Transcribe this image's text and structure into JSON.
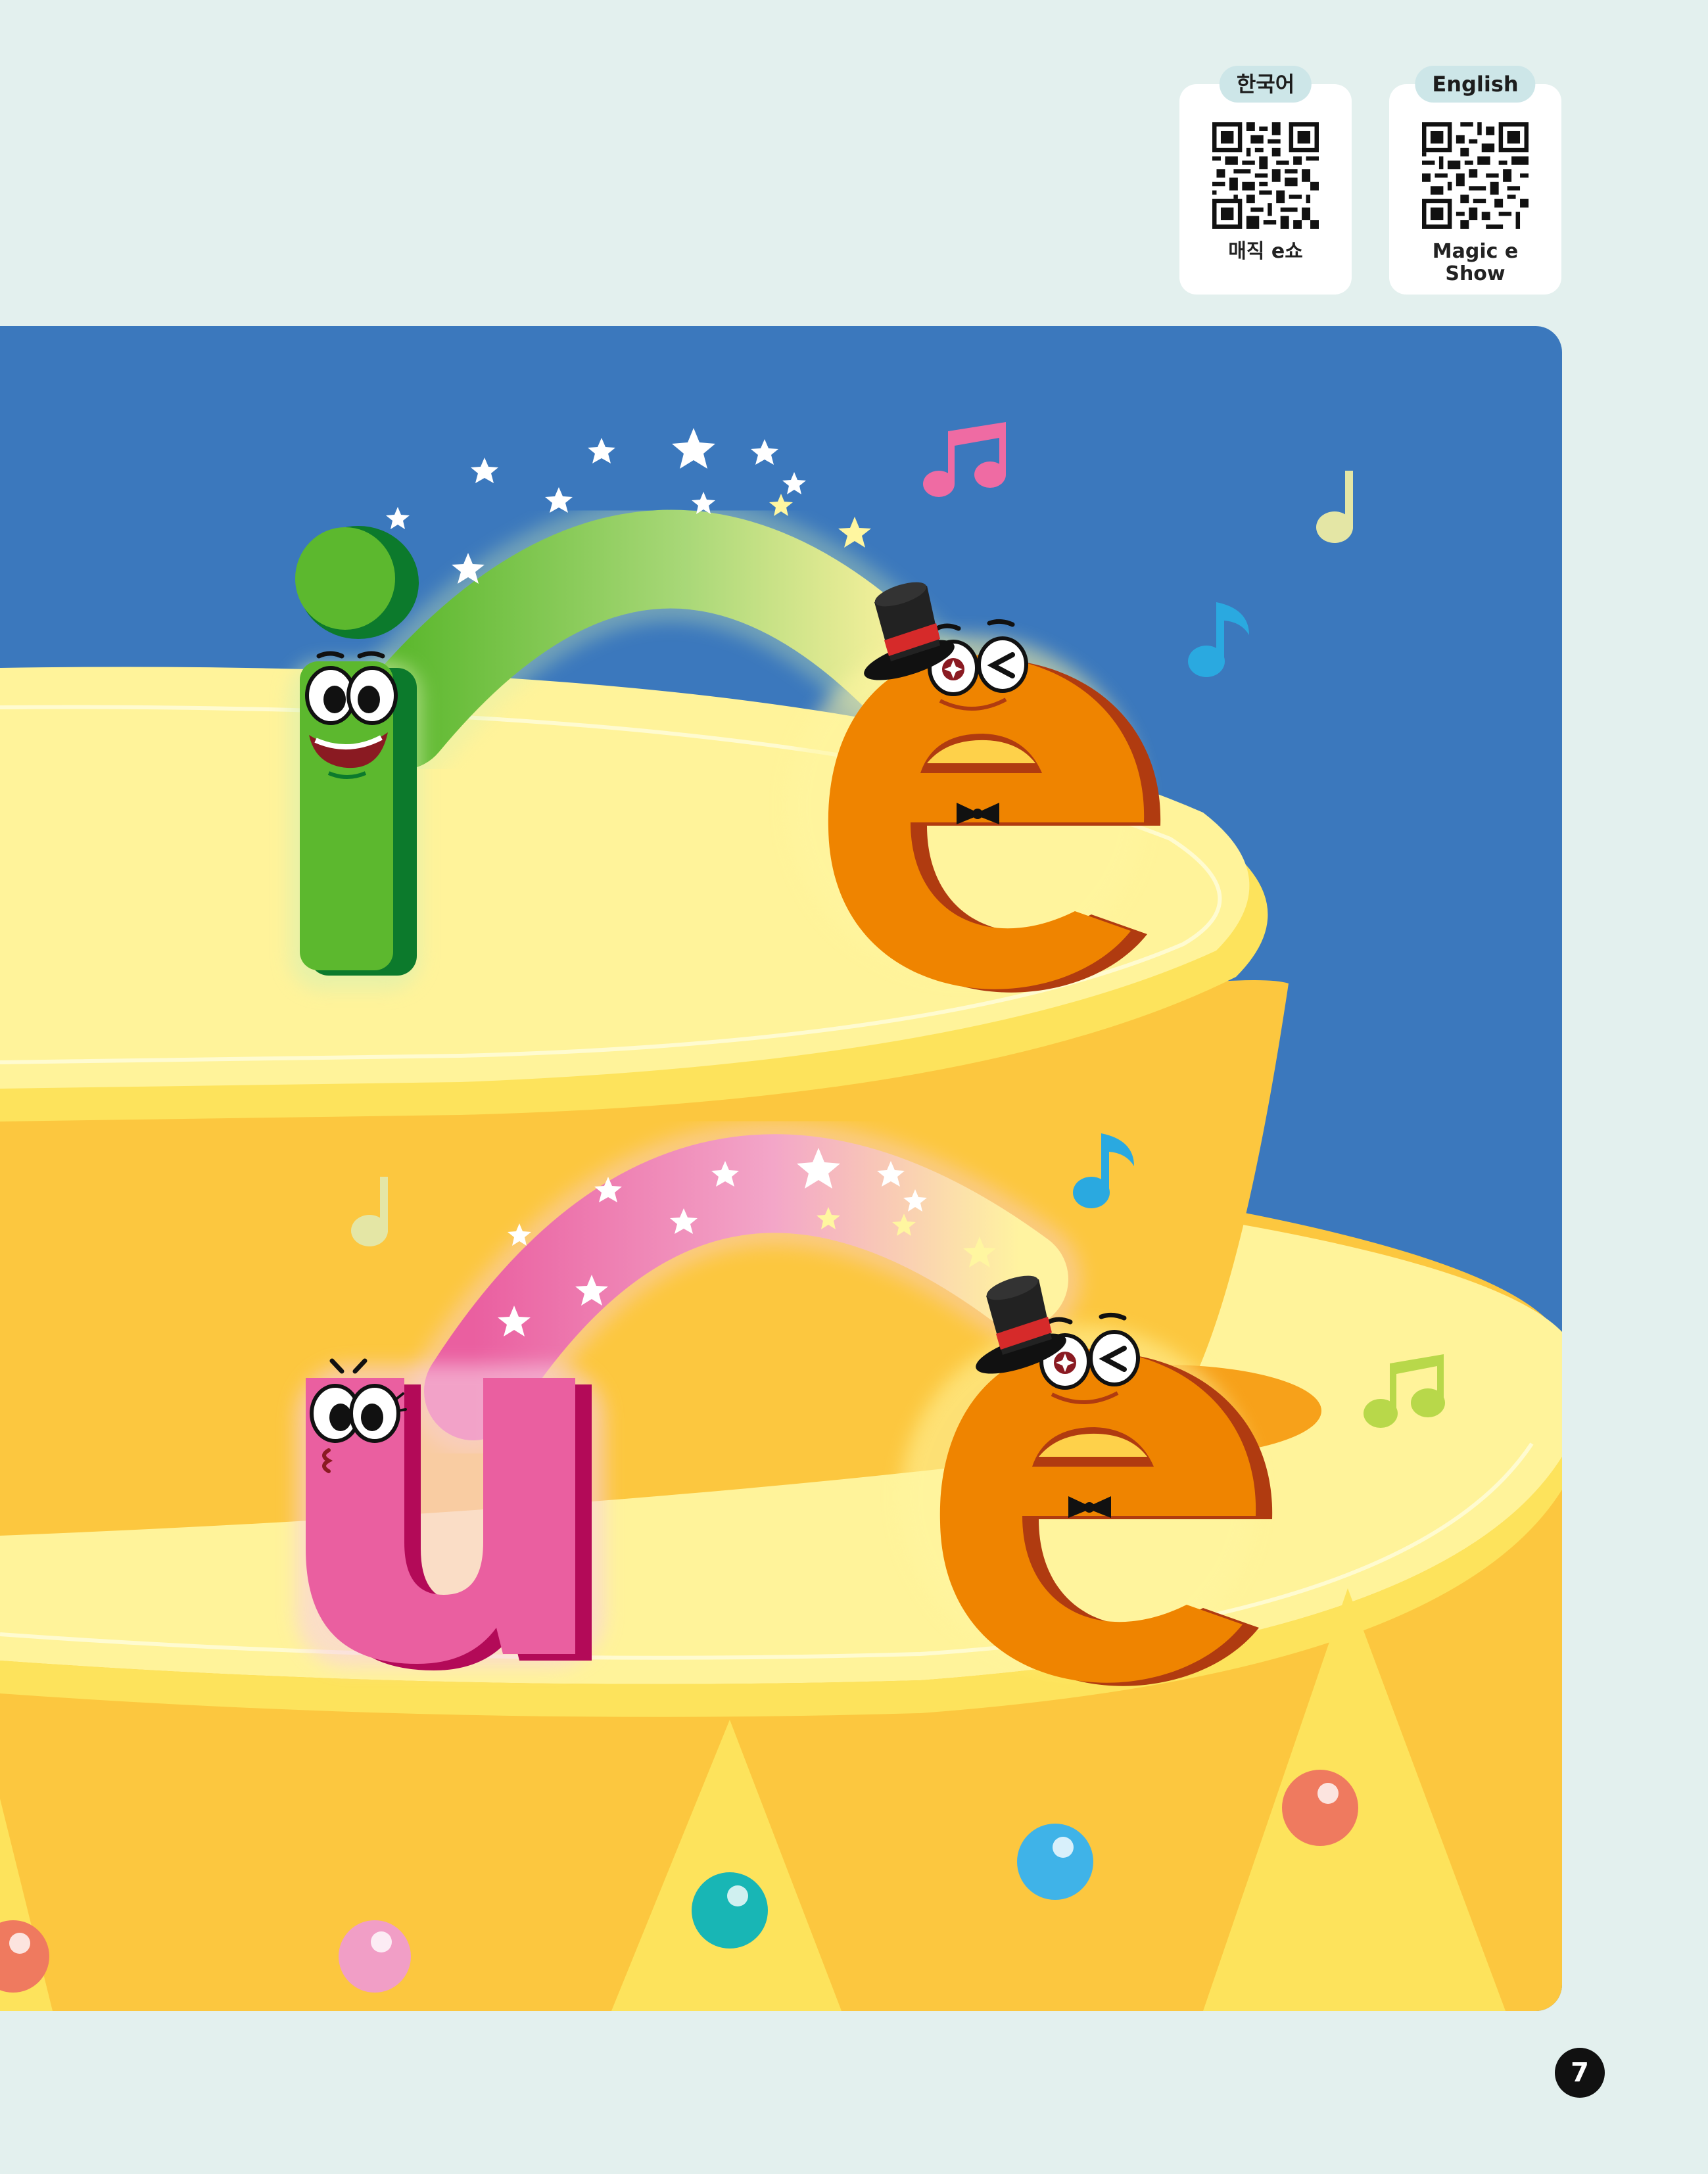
{
  "qr_codes": [
    {
      "tag": "한국어",
      "caption": "매직 e쇼"
    },
    {
      "tag": "English",
      "caption": "Magic e\nShow"
    }
  ],
  "illustration": {
    "pairs": [
      {
        "letter": "i",
        "letter_color": "#5cb82e",
        "magic_letter": "e",
        "magic_color": "#ef8400",
        "arc_color": "#5cb82e"
      },
      {
        "letter": "u",
        "letter_color": "#ea5fa0",
        "magic_letter": "e",
        "magic_color": "#ef8400",
        "arc_color": "#ea5fa0"
      }
    ],
    "colors": {
      "sky": "#3b78bd",
      "cake_top": "#fff39a",
      "cake_side": "#fcc73f",
      "background": "#e3f0ee"
    }
  },
  "page_number": "7"
}
